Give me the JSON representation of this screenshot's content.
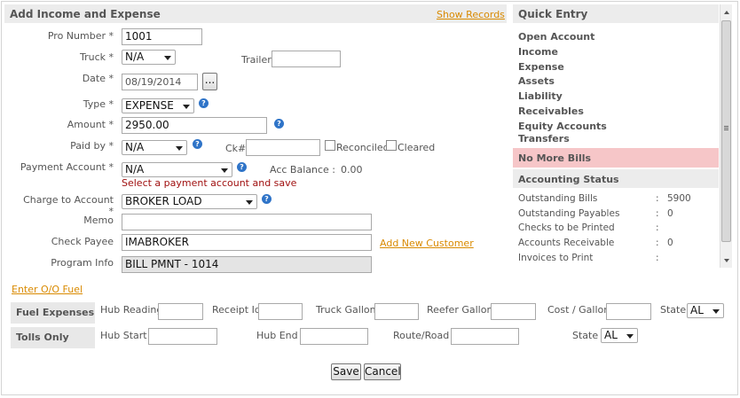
{
  "form": {
    "title": "Add Income and Expense",
    "show_records": "Show Records",
    "pro_number": {
      "label": "Pro Number *",
      "value": "1001"
    },
    "truck": {
      "label": "Truck *",
      "value": "N/A"
    },
    "trailer": {
      "label": "Trailer",
      "value": ""
    },
    "date": {
      "label": "Date *",
      "value": "08/19/2014",
      "picker": "..."
    },
    "type": {
      "label": "Type *",
      "value": "EXPENSE"
    },
    "amount": {
      "label": "Amount *",
      "value": "2950.00"
    },
    "paid_by": {
      "label": "Paid by *",
      "value": "N/A"
    },
    "ck": {
      "label": "Ck#",
      "value": ""
    },
    "reconciled": "Reconciled",
    "cleared": "Cleared",
    "payment_account": {
      "label": "Payment Account *",
      "value": "N/A"
    },
    "acc_balance": {
      "label": "Acc Balance :",
      "value": "0.00"
    },
    "error": "Select a payment account and save",
    "charge_to_account": {
      "label": "Charge to Account *",
      "value": "BROKER LOAD"
    },
    "memo": {
      "label": "Memo",
      "value": ""
    },
    "check_payee": {
      "label": "Check Payee",
      "value": "IMABROKER"
    },
    "add_customer": "Add New Customer",
    "program_info": {
      "label": "Program Info",
      "value": "BILL PMNT - 1014"
    },
    "help_glyph": "?"
  },
  "enter_oo_fuel": "Enter O/O Fuel",
  "fuel": {
    "title": "Fuel Expenses",
    "hub_reading": "Hub Reading",
    "receipt_id": "Receipt Id",
    "truck_gallon": "Truck Gallon",
    "reefer_gallon": "Reefer Gallon",
    "cost_gallon": "Cost / Gallon",
    "state_label": "State",
    "state_value": "AL"
  },
  "tolls": {
    "title": "Tolls Only",
    "hub_start": "Hub Start",
    "hub_end": "Hub End",
    "route_road": "Route/Road",
    "state_label": "State",
    "state_value": "AL"
  },
  "buttons": {
    "save": "Save",
    "cancel": "Cancel"
  },
  "quick_entry": {
    "title": "Quick Entry",
    "items": [
      "Open Account",
      "Income",
      "Expense",
      "Assets",
      "Liability",
      "Receivables",
      "Equity Accounts",
      "Transfers"
    ],
    "alert": "No More Bills",
    "status_title": "Accounting Status",
    "stats": [
      {
        "label": "Outstanding Bills",
        "value": "5900"
      },
      {
        "label": "Outstanding Payables",
        "value": "0"
      },
      {
        "label": "Checks to be Printed",
        "value": ""
      },
      {
        "label": "Accounts Receivable",
        "value": "0"
      },
      {
        "label": "Invoices to Print",
        "value": ""
      }
    ],
    "colon": ":"
  },
  "colors": {
    "accent_link": "#d98a00",
    "alert_bg": "#f6c6c8",
    "help_blue": "#2f74c8",
    "error": "#a01010"
  }
}
